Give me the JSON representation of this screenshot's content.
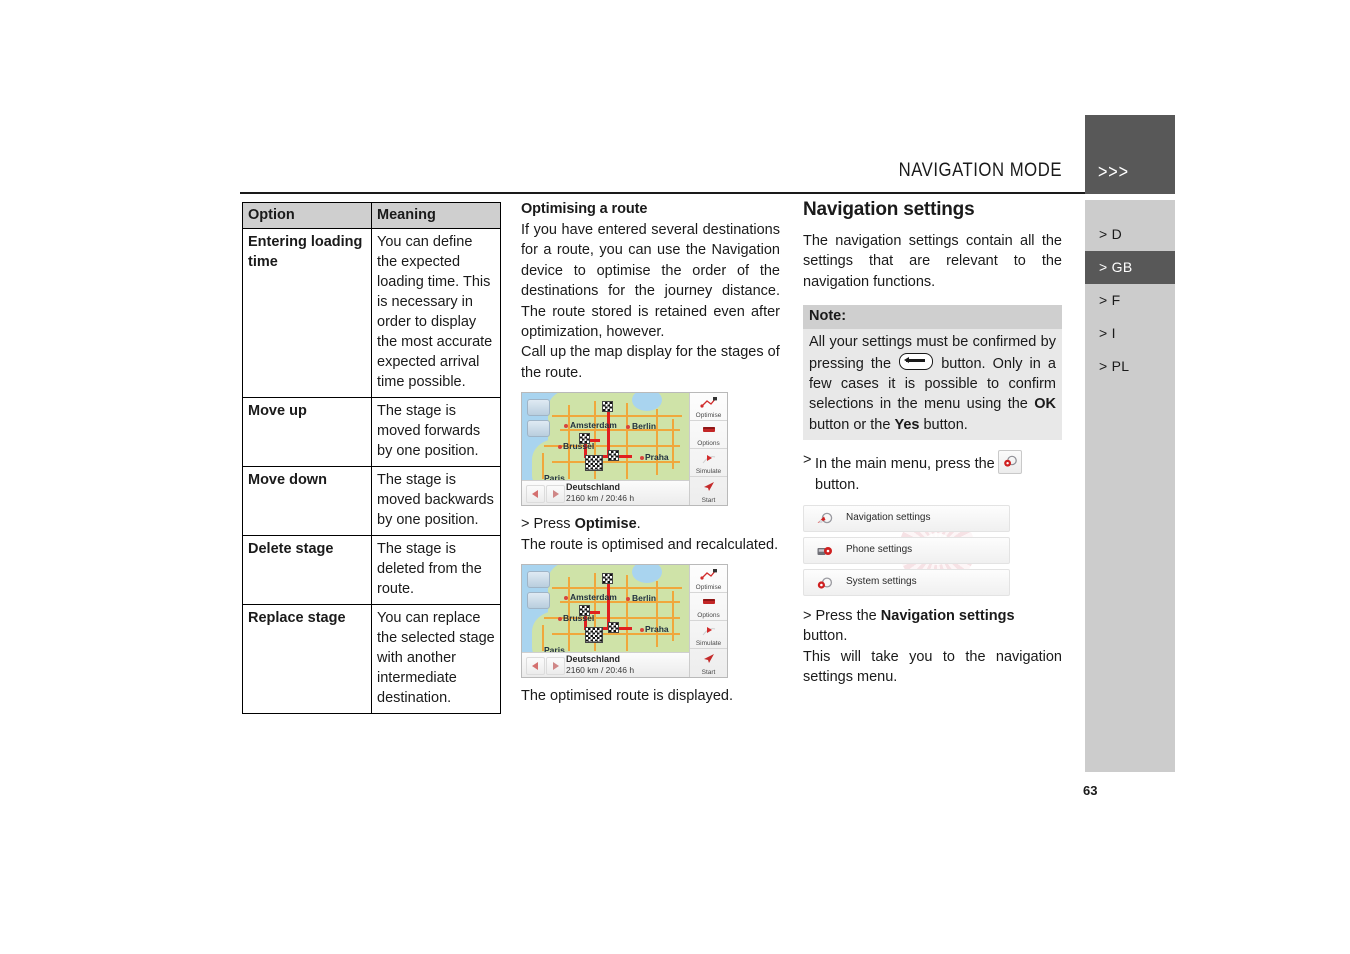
{
  "header": {
    "title": "NAVIGATION MODE",
    "chevrons": ">>>"
  },
  "sidebar": {
    "items": [
      {
        "label": "> D",
        "active": false
      },
      {
        "label": "> GB",
        "active": true
      },
      {
        "label": "> F",
        "active": false
      },
      {
        "label": "> I",
        "active": false
      },
      {
        "label": "> PL",
        "active": false
      }
    ]
  },
  "page_number": "63",
  "table": {
    "headers": [
      "Option",
      "Meaning"
    ],
    "rows": [
      {
        "option": "Entering loading time",
        "meaning": "You can define the expected loading time. This is necessary in order to display the most accurate expected arrival time possible."
      },
      {
        "option": "Move up",
        "meaning": "The stage is moved forwards by one position."
      },
      {
        "option": "Move down",
        "meaning": "The stage is moved backwards by one position."
      },
      {
        "option": "Delete stage",
        "meaning": "The stage is deleted from the route."
      },
      {
        "option": "Replace stage",
        "meaning": "You can replace the selected stage with another intermediate destination."
      }
    ]
  },
  "column2": {
    "subheading": "Optimising a route",
    "paragraph1": "If you have entered several destinations for a route, you can use the Navigation device to optimise the order of the destinations for the journey distance. The route stored is retained even after optimization, however.",
    "paragraph2": "Call up the map display for the stages of the route.",
    "step_prefix": "> Press ",
    "step_bold": "Optimise",
    "step_suffix": ".",
    "step_result": "The route is optimised and recalculated.",
    "caption_after": "The optimised route is displayed."
  },
  "device_screen": {
    "destination": "Deutschland",
    "distance": "2160 km / 20:46 h",
    "buttons": [
      "Optimise",
      "Options",
      "Simulate",
      "Start"
    ],
    "cities": [
      "Amsterdam",
      "Berlin",
      "Brussel",
      "Praha",
      "Paris"
    ],
    "zoom_in_icon": "plus-icon",
    "zoom_out_icon": "minus-icon",
    "prev_icon": "left-arrow-icon",
    "next_icon": "right-arrow-icon"
  },
  "column3": {
    "heading": "Navigation settings",
    "intro": "The navigation settings contain all the settings that are relevant to the navigation functions.",
    "note": {
      "title": "Note:",
      "part1": "All your settings must be confirmed by pressing the ",
      "icon_name": "back-button-icon",
      "part2": " button. Only in a few cases it is possible to confirm selections in the menu using the ",
      "bold1": "OK",
      "part3": " button or the ",
      "bold2": "Yes",
      "part4": " button."
    },
    "step_main_menu": {
      "marker": ">",
      "text1": "In the main menu, press the",
      "icon_name": "settings-button-icon",
      "text2": "button."
    },
    "settings_menu": {
      "items": [
        {
          "label": "Navigation settings",
          "icon": "navigation-settings-icon"
        },
        {
          "label": "Phone settings",
          "icon": "phone-settings-icon"
        },
        {
          "label": "System settings",
          "icon": "system-settings-icon"
        }
      ]
    },
    "final_step": {
      "prefix": "> Press the ",
      "bold": "Navigation settings",
      "suffix": " button.",
      "result": "This will take you to the navigation settings menu."
    }
  },
  "colors": {
    "accent_dark": "#585858",
    "panel_gray": "#cccccc",
    "table_head": "#cfcfcf",
    "note_body": "#e8e8e8",
    "route_red": "#e02020",
    "road_orange": "#f0a73c",
    "land_green": "#cfe3a8",
    "sea_blue": "#a9d4ef"
  }
}
